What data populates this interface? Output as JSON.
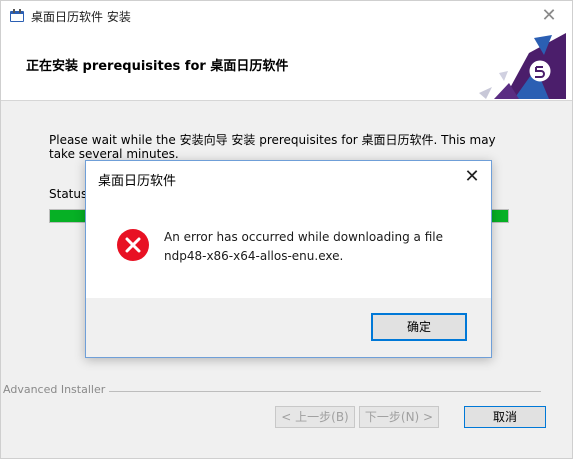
{
  "window": {
    "title": "桌面日历软件 安装",
    "close_glyph": "✕"
  },
  "header": {
    "title": "正在安装 prerequisites for 桌面日历软件"
  },
  "body": {
    "message": "Please wait while the 安装向导 安装 prerequisites for 桌面日历软件.  This may take several minutes.",
    "status_label": "Status",
    "progress_percent": 100
  },
  "branding": {
    "text": "Advanced Installer"
  },
  "buttons": {
    "back": "< 上一步(B)",
    "next": "下一步(N) >",
    "cancel": "取消"
  },
  "dialog": {
    "title": "桌面日历软件",
    "close_glyph": "✕",
    "message_line1": "An error has occurred while downloading a file",
    "message_line2": "ndp48-x86-x64-allos-enu.exe.",
    "ok": "确定",
    "icon": "error-icon"
  },
  "colors": {
    "progress": "#06b025",
    "error_red": "#e81123",
    "accent": "#0078d7",
    "logo_purple": "#4b1e6b",
    "logo_blue": "#2b5fb3"
  }
}
